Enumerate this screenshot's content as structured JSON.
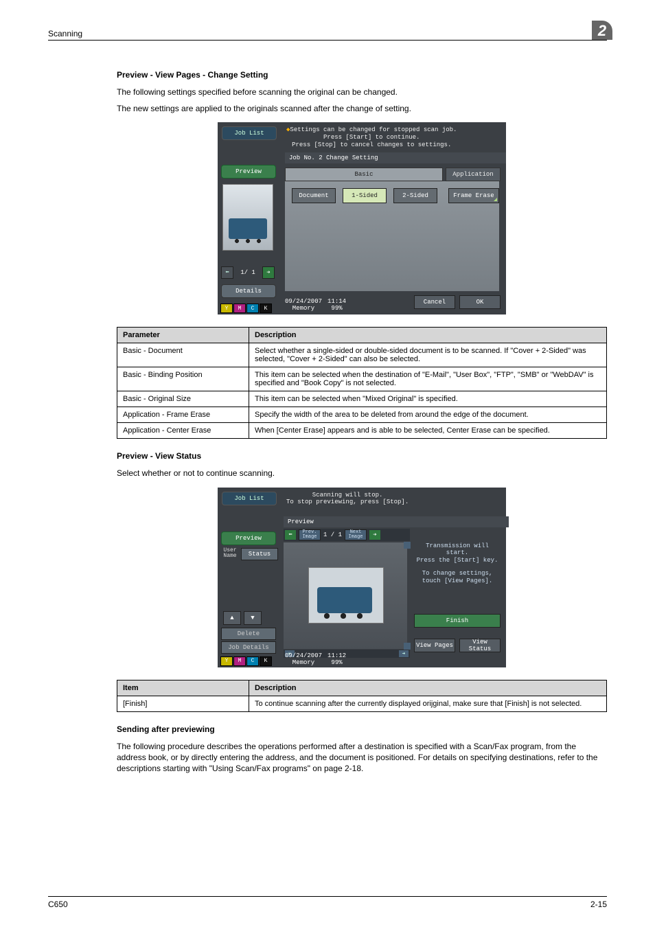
{
  "header": {
    "section": "Scanning",
    "chapter": "2"
  },
  "h1": "Preview - View Pages - Change Setting",
  "p1": "The following settings specified before scanning the original can be changed.",
  "p2": "The new settings are applied to the originals scanned after the change of setting.",
  "shot1": {
    "joblist": "Job List",
    "preview": "Preview",
    "details": "Details",
    "pager": {
      "text": "1/   1"
    },
    "msg1": "Settings can be changed for stopped scan job.",
    "msg2": "Press [Start] to continue.",
    "msg3": "Press [Stop] to cancel changes to settings.",
    "jobno": "Job No.       2   Change Setting",
    "tab_basic": "Basic",
    "tab_app": "Application",
    "chip_doc": "Document",
    "chip_1s": "1-Sided",
    "chip_2s": "2-Sided",
    "chip_fe": "Frame Erase",
    "date": "09/24/2007",
    "time": "11:14",
    "memory": "Memory",
    "mempct": "99%",
    "cancel": "Cancel",
    "ok": "OK",
    "toners": {
      "y": "Y",
      "m": "M",
      "c": "C",
      "k": "K"
    }
  },
  "table1": {
    "head": {
      "param": "Parameter",
      "desc": "Description"
    },
    "rows": [
      {
        "k": "Basic - Document",
        "v": "Select whether a single-sided or double-sided document is to be scanned. If \"Cover + 2-Sided\" was selected, \"Cover + 2-Sided\" can also be selected."
      },
      {
        "k": "Basic - Binding Position",
        "v": "This item can be selected when the destination of \"E-Mail\", \"User Box\", \"FTP\", \"SMB\" or \"WebDAV\" is specified and \"Book Copy\" is not selected."
      },
      {
        "k": "Basic - Original Size",
        "v": "This item can be selected when \"Mixed Original\" is specified."
      },
      {
        "k": "Application - Frame Erase",
        "v": "Specify the width of the area to be deleted from around the edge of the document."
      },
      {
        "k": "Application - Center Erase",
        "v": "When [Center Erase] appears and is able to be selected, Center Erase can be specified."
      }
    ]
  },
  "h2": "Preview - View Status",
  "p3": "Select whether or not to continue scanning.",
  "shot2": {
    "joblist": "Job List",
    "preview": "Preview",
    "username": "User Name",
    "status": "Status",
    "delete": "Delete",
    "jobdetails": "Job Details",
    "topmsg1": "Scanning will stop.",
    "topmsg2": "To stop previewing, press [Stop].",
    "previewlbl": "Preview",
    "prev_image": "Prev. Image",
    "next_image": "Next Image",
    "pager": "1 /    1",
    "side1": "Transmission will start.",
    "side2": "Press the [Start] key.",
    "side3": "To change settings,",
    "side4": "touch [View Pages].",
    "finish": "Finish",
    "viewpages": "View Pages",
    "viewstatus": "View Status",
    "date": "09/24/2007",
    "time": "11:12",
    "memory": "Memory",
    "mempct": "99%",
    "toners": {
      "y": "Y",
      "m": "M",
      "c": "C",
      "k": "K"
    }
  },
  "table2": {
    "head": {
      "item": "Item",
      "desc": "Description"
    },
    "rows": [
      {
        "k": "[Finish]",
        "v": "To continue scanning after the currently displayed orijginal, make sure that [Finish] is not selected."
      }
    ]
  },
  "h3": "Sending after previewing",
  "p4": "The following procedure describes the operations performed after a destination is specified with a Scan/Fax program, from the address book, or by directly entering the address, and the document is positioned. For details on specifying destinations, refer to the descriptions starting with \"Using Scan/Fax programs\" on page 2-18.",
  "footer": {
    "left": "C650",
    "right": "2-15"
  }
}
